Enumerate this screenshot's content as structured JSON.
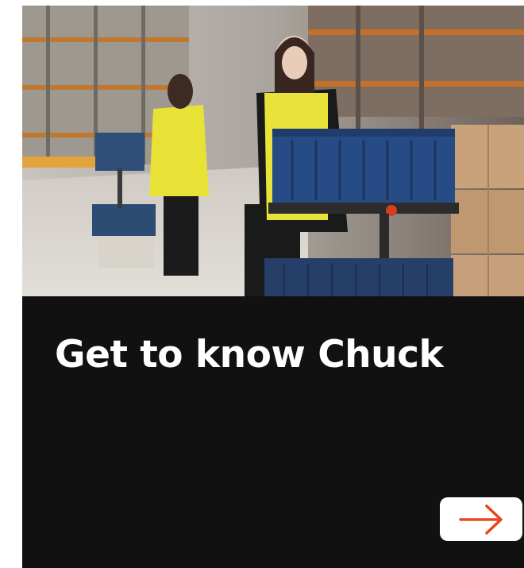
{
  "card": {
    "title": "Get to know Chuck",
    "image_description_icon": "warehouse-photo",
    "cta_icon": "arrow-right-icon",
    "colors": {
      "panel_background": "#111111",
      "title_text": "#ffffff",
      "button_background": "#ffffff",
      "arrow_accent": "#e8461b"
    }
  }
}
